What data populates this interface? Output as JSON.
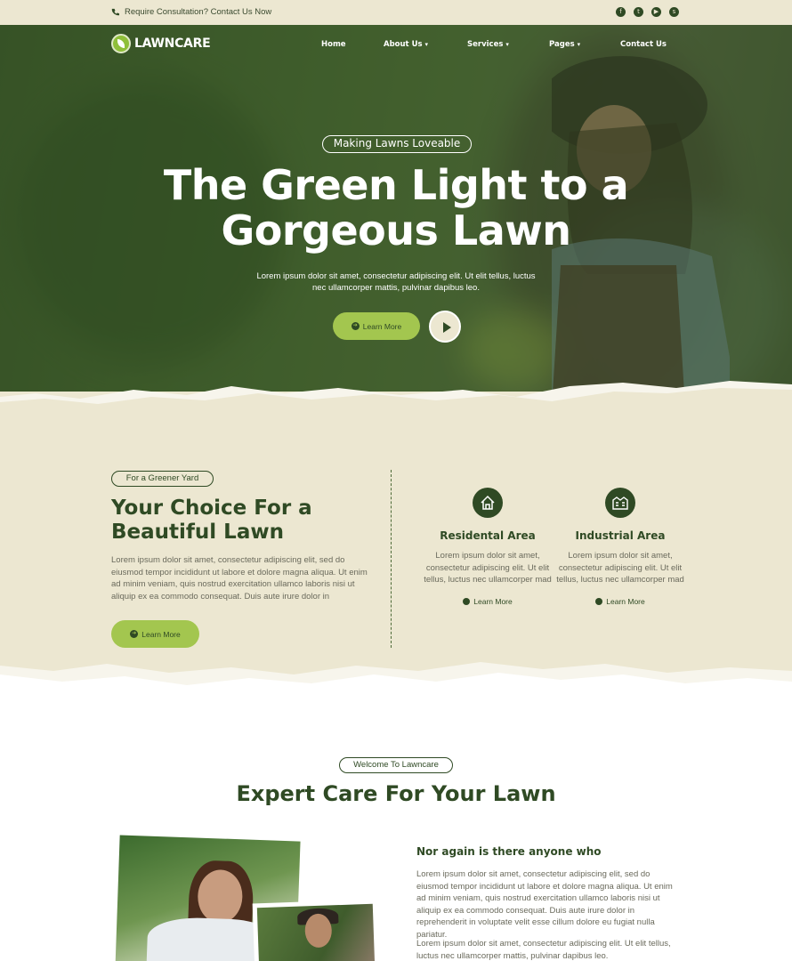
{
  "topbar": {
    "contact_text": "Require Consultation? Contact Us Now",
    "socials": [
      "facebook-icon",
      "twitter-icon",
      "youtube-icon",
      "skype-icon"
    ]
  },
  "nav": {
    "logo": "LAWNCARE",
    "items": [
      {
        "label": "Home",
        "has_dropdown": false
      },
      {
        "label": "About Us",
        "has_dropdown": true
      },
      {
        "label": "Services",
        "has_dropdown": true
      },
      {
        "label": "Pages",
        "has_dropdown": true
      },
      {
        "label": "Contact Us",
        "has_dropdown": false
      }
    ]
  },
  "hero": {
    "eyebrow": "Making Lawns Loveable",
    "title_line1": "The Green Light to a",
    "title_line2": "Gorgeous Lawn",
    "lead": "Lorem ipsum dolor sit amet, consectetur adipiscing elit. Ut elit tellus, luctus nec ullamcorper mattis, pulvinar dapibus leo.",
    "button": "Learn More"
  },
  "choice": {
    "eyebrow": "For a Greener Yard",
    "title": "Your Choice For a Beautiful Lawn",
    "body": "Lorem ipsum dolor sit amet, consectetur adipiscing elit, sed do eiusmod tempor incididunt ut labore et dolore magna aliqua. Ut enim ad minim veniam, quis nostrud exercitation ullamco laboris nisi ut aliquip ex ea commodo consequat. Duis aute irure dolor in",
    "button": "Learn More",
    "areas": [
      {
        "title": "Residental Area",
        "text": "Lorem ipsum dolor sit amet, consectetur adipiscing elit. Ut elit tellus, luctus nec ullamcorper mad",
        "link": "Learn More",
        "icon": "house-icon"
      },
      {
        "title": "Industrial Area",
        "text": "Lorem ipsum dolor sit amet, consectetur adipiscing elit. Ut elit tellus, luctus nec ullamcorper mad",
        "link": "Learn More",
        "icon": "factory-icon"
      }
    ]
  },
  "welcome": {
    "eyebrow": "Welcome To Lawncare",
    "title": "Expert Care For Your Lawn",
    "subtitle": "Nor again is there anyone who",
    "p1": "Lorem ipsum dolor sit amet, consectetur adipiscing elit, sed do eiusmod tempor incididunt ut labore et dolore magna aliqua. Ut enim ad minim veniam, quis nostrud exercitation ullamco laboris nisi ut aliquip ex ea commodo consequat. Duis aute irure dolor in reprehenderit in voluptate velit esse cillum dolore eu fugiat nulla pariatur.",
    "p2": "Lorem ipsum dolor sit amet, consectetur adipiscing elit. Ut elit tellus, luctus nec ullamcorper mattis, pulvinar dapibus leo."
  },
  "colors": {
    "dark_green": "#2f4a24",
    "lime": "#a3c64f",
    "beige": "#ece7d1"
  }
}
